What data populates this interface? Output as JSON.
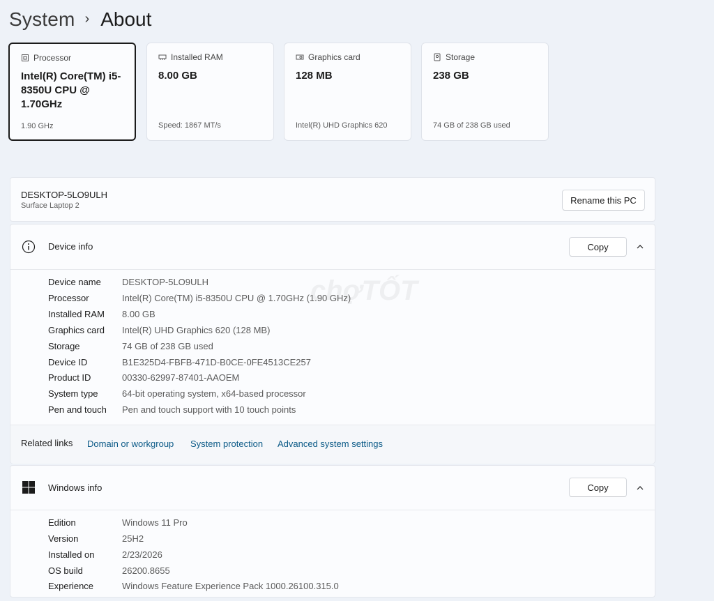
{
  "breadcrumb": {
    "parent": "System",
    "separator": "›",
    "current": "About"
  },
  "specs": [
    {
      "label": "Processor",
      "value": "Intel(R) Core(TM) i5-8350U CPU @ 1.70GHz",
      "sub": "1.90 GHz",
      "icon": "processor-icon"
    },
    {
      "label": "Installed RAM",
      "value": "8.00 GB",
      "sub": "Speed: 1867 MT/s",
      "icon": "ram-icon"
    },
    {
      "label": "Graphics card",
      "value": "128 MB",
      "sub": "Intel(R) UHD Graphics 620",
      "icon": "graphics-card-icon"
    },
    {
      "label": "Storage",
      "value": "238 GB",
      "sub": "74 GB of 238 GB used",
      "icon": "storage-icon"
    }
  ],
  "pc": {
    "name": "DESKTOP-5LO9ULH",
    "model": "Surface Laptop 2",
    "rename_label": "Rename this PC"
  },
  "device_info": {
    "title": "Device info",
    "copy_label": "Copy",
    "rows": [
      {
        "label": "Device name",
        "value": "DESKTOP-5LO9ULH"
      },
      {
        "label": "Processor",
        "value": "Intel(R) Core(TM) i5-8350U CPU @ 1.70GHz (1.90 GHz)"
      },
      {
        "label": "Installed RAM",
        "value": "8.00 GB"
      },
      {
        "label": "Graphics card",
        "value": "Intel(R) UHD Graphics 620 (128 MB)"
      },
      {
        "label": "Storage",
        "value": "74 GB of 238 GB used"
      },
      {
        "label": "Device ID",
        "value": "B1E325D4-FBFB-471D-B0CE-0FE4513CE257"
      },
      {
        "label": "Product ID",
        "value": "00330-62997-87401-AAOEM"
      },
      {
        "label": "System type",
        "value": "64-bit operating system, x64-based processor"
      },
      {
        "label": "Pen and touch",
        "value": "Pen and touch support with 10 touch points"
      }
    ]
  },
  "related_links": {
    "label": "Related links",
    "links": [
      "Domain or workgroup",
      "System protection",
      "Advanced system settings"
    ]
  },
  "windows_info": {
    "title": "Windows info",
    "copy_label": "Copy",
    "rows": [
      {
        "label": "Edition",
        "value": "Windows 11 Pro"
      },
      {
        "label": "Version",
        "value": "25H2"
      },
      {
        "label": "Installed on",
        "value": "2/23/2026"
      },
      {
        "label": "OS build",
        "value": "26200.8655"
      },
      {
        "label": "Experience",
        "value": "Windows Feature Experience Pack 1000.26100.315.0"
      }
    ]
  },
  "watermark": "chợTỐT",
  "colors": {
    "accent_link": "#0b5a87",
    "background": "#eef2f8",
    "card": "#fbfcfe"
  }
}
